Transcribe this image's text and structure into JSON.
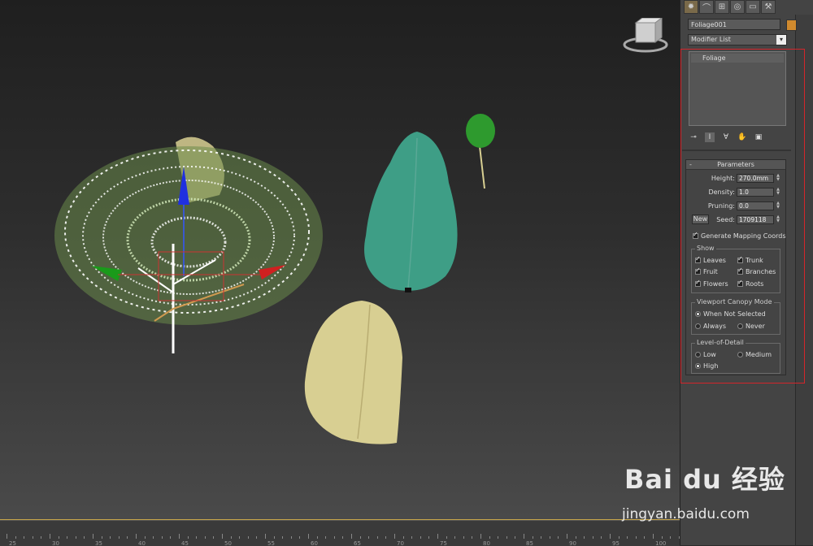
{
  "panel": {
    "tabs": [
      {
        "icon": "sun-icon",
        "glyph": "✹"
      },
      {
        "icon": "curve-icon",
        "glyph": "⌒"
      },
      {
        "icon": "hierarchy-icon",
        "glyph": "⊞"
      },
      {
        "icon": "motion-icon",
        "glyph": "◎"
      },
      {
        "icon": "display-icon",
        "glyph": "▭"
      },
      {
        "icon": "hammer-icon",
        "glyph": "⚒"
      }
    ],
    "object_name": "Foliage001",
    "object_color": "#d08a2e",
    "modifier_list": "Modifier List",
    "stack_items": [
      "Foliage"
    ],
    "parameters": {
      "title": "Parameters",
      "collapse_symbol": "-",
      "height_label": "Height:",
      "height_value": "270.0mm",
      "density_label": "Density:",
      "density_value": "1.0",
      "pruning_label": "Pruning:",
      "pruning_value": "0.0",
      "new_label": "New",
      "seed_label": "Seed:",
      "seed_value": "1709118",
      "gen_mapping_label": "Generate Mapping Coords",
      "gen_mapping_checked": true,
      "show": {
        "title": "Show",
        "leaves": "Leaves",
        "trunk": "Trunk",
        "fruit": "Fruit",
        "branches": "Branches",
        "flowers": "Flowers",
        "roots": "Roots"
      },
      "canopy": {
        "title": "Viewport Canopy Mode",
        "when_not_selected": "When Not Selected",
        "always": "Always",
        "never": "Never",
        "selected": "when_not_selected"
      },
      "lod": {
        "title": "Level-of-Detail",
        "low": "Low",
        "medium": "Medium",
        "high": "High",
        "selected": "high"
      }
    }
  },
  "ruler": {
    "numbers": [
      "25",
      "30",
      "35",
      "40",
      "45",
      "50",
      "55",
      "60",
      "65",
      "70",
      "75",
      "80",
      "85",
      "90",
      "95",
      "100"
    ]
  },
  "watermark": {
    "brand": "Bai du 经验",
    "url": "jingyan.baidu.com"
  },
  "colors": {
    "highlight_box": "#d3252b",
    "tree_green": "#3e9e86",
    "tree_yellow": "#d8cf92",
    "small_tree": "#2e9a2e"
  }
}
